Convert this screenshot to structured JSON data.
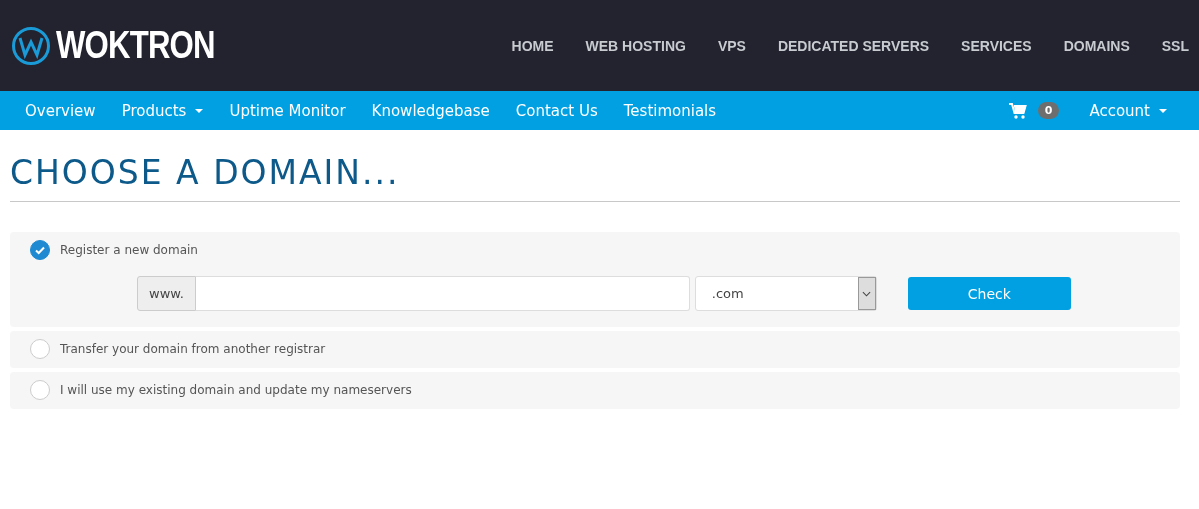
{
  "brand": {
    "name": "WOKTRON"
  },
  "top_nav": [
    "HOME",
    "WEB HOSTING",
    "VPS",
    "DEDICATED SERVERS",
    "SERVICES",
    "DOMAINS",
    "SSL"
  ],
  "sub_nav": [
    {
      "label": "Overview",
      "dropdown": false
    },
    {
      "label": "Products",
      "dropdown": true
    },
    {
      "label": "Uptime Monitor",
      "dropdown": false
    },
    {
      "label": "Knowledgebase",
      "dropdown": false
    },
    {
      "label": "Contact Us",
      "dropdown": false
    },
    {
      "label": "Testimonials",
      "dropdown": false
    }
  ],
  "cart": {
    "count": "0"
  },
  "account": {
    "label": "Account",
    "dropdown": true
  },
  "page_title": "CHOOSE A DOMAIN...",
  "options": [
    {
      "label": "Register a new domain",
      "selected": true
    },
    {
      "label": "Transfer your domain from another registrar",
      "selected": false
    },
    {
      "label": "I will use my existing domain and update my nameservers",
      "selected": false
    }
  ],
  "domain_form": {
    "prefix": "www.",
    "tld": ".com",
    "button": "Check"
  }
}
